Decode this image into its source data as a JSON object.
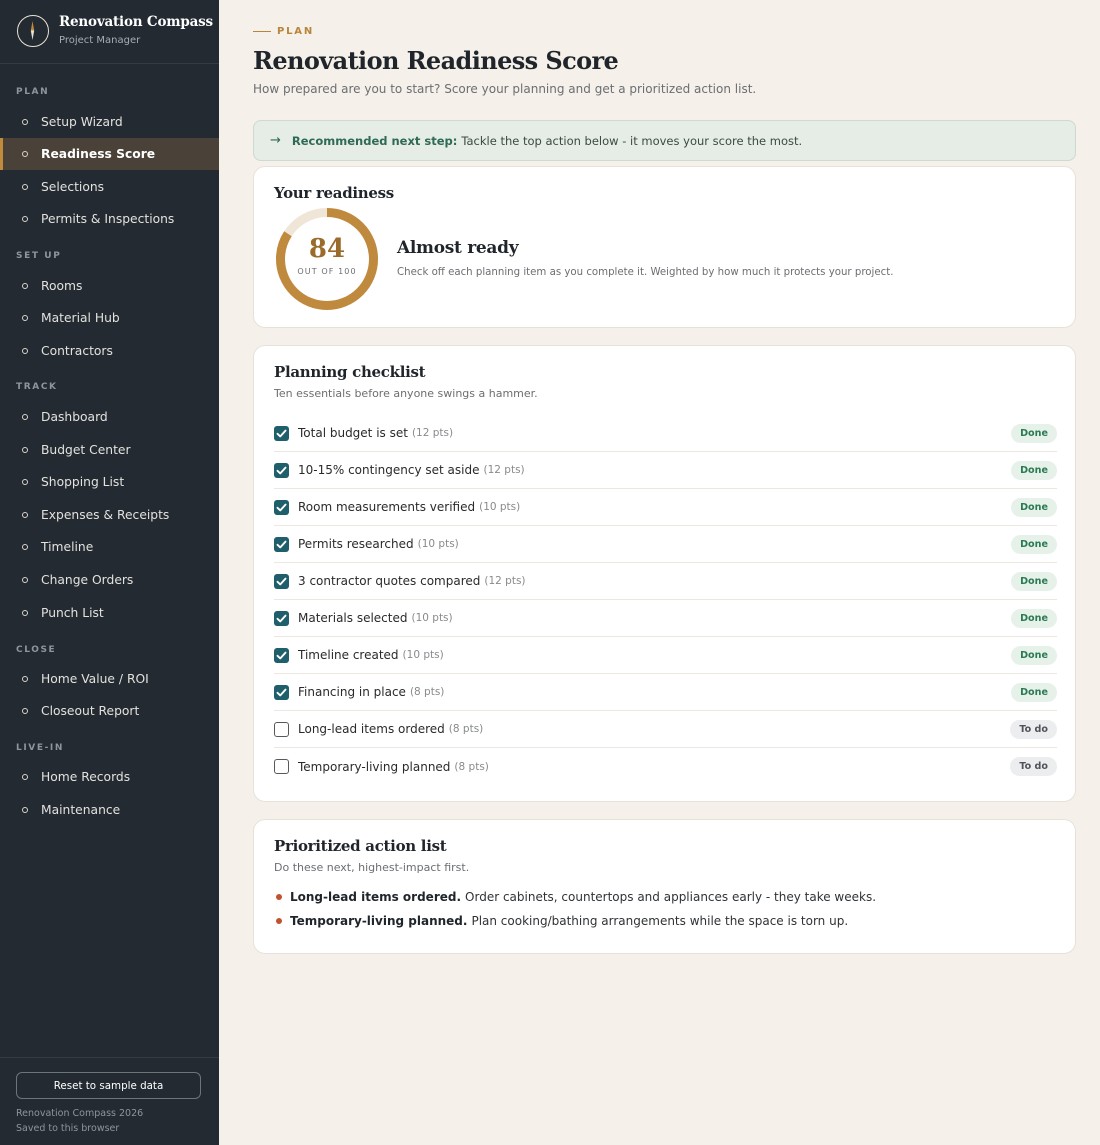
{
  "brand": {
    "title": "Renovation Compass",
    "subtitle": "Project Manager"
  },
  "sidebar": {
    "sections": [
      {
        "label": "PLAN",
        "items": [
          {
            "label": "Setup Wizard",
            "active": false
          },
          {
            "label": "Readiness Score",
            "active": true
          },
          {
            "label": "Selections",
            "active": false
          },
          {
            "label": "Permits & Inspections",
            "active": false
          }
        ]
      },
      {
        "label": "SET UP",
        "items": [
          {
            "label": "Rooms",
            "active": false
          },
          {
            "label": "Material Hub",
            "active": false
          },
          {
            "label": "Contractors",
            "active": false
          }
        ]
      },
      {
        "label": "TRACK",
        "items": [
          {
            "label": "Dashboard",
            "active": false
          },
          {
            "label": "Budget Center",
            "active": false
          },
          {
            "label": "Shopping List",
            "active": false
          },
          {
            "label": "Expenses & Receipts",
            "active": false
          },
          {
            "label": "Timeline",
            "active": false
          },
          {
            "label": "Change Orders",
            "active": false
          },
          {
            "label": "Punch List",
            "active": false
          }
        ]
      },
      {
        "label": "CLOSE",
        "items": [
          {
            "label": "Home Value / ROI",
            "active": false
          },
          {
            "label": "Closeout Report",
            "active": false
          }
        ]
      },
      {
        "label": "LIVE-IN",
        "items": [
          {
            "label": "Home Records",
            "active": false
          },
          {
            "label": "Maintenance",
            "active": false
          }
        ]
      }
    ],
    "reset_label": "Reset to sample data",
    "footer_line1": "Renovation Compass 2026",
    "footer_line2": "Saved to this browser"
  },
  "header": {
    "eyebrow": "PLAN",
    "title": "Renovation Readiness Score",
    "subtitle": "How prepared are you to start? Score your planning and get a prioritized action list."
  },
  "recommendation": {
    "icon": "arrow-right-icon",
    "label": "Recommended next step:",
    "text": "Tackle the top action below - it moves your score the most."
  },
  "readiness": {
    "title": "Your readiness",
    "score": "84",
    "score_value": 84,
    "score_max": 100,
    "score_caption": "OUT OF 100",
    "status": "Almost ready",
    "description": "Check off each planning item as you complete it. Weighted by how much it protects your project.",
    "colors": {
      "ring": "#c08a3e",
      "track": "#efe6d8"
    }
  },
  "checklist": {
    "title": "Planning checklist",
    "subtitle": "Ten essentials before anyone swings a hammer.",
    "items": [
      {
        "label": "Total budget is set",
        "pts": "(12 pts)",
        "checked": true,
        "status": "Done"
      },
      {
        "label": "10-15% contingency set aside",
        "pts": "(12 pts)",
        "checked": true,
        "status": "Done"
      },
      {
        "label": "Room measurements verified",
        "pts": "(10 pts)",
        "checked": true,
        "status": "Done"
      },
      {
        "label": "Permits researched",
        "pts": "(10 pts)",
        "checked": true,
        "status": "Done"
      },
      {
        "label": "3 contractor quotes compared",
        "pts": "(12 pts)",
        "checked": true,
        "status": "Done"
      },
      {
        "label": "Materials selected",
        "pts": "(10 pts)",
        "checked": true,
        "status": "Done"
      },
      {
        "label": "Timeline created",
        "pts": "(10 pts)",
        "checked": true,
        "status": "Done"
      },
      {
        "label": "Financing in place",
        "pts": "(8 pts)",
        "checked": true,
        "status": "Done"
      },
      {
        "label": "Long-lead items ordered",
        "pts": "(8 pts)",
        "checked": false,
        "status": "To do"
      },
      {
        "label": "Temporary-living planned",
        "pts": "(8 pts)",
        "checked": false,
        "status": "To do"
      }
    ]
  },
  "actions": {
    "title": "Prioritized action list",
    "subtitle": "Do these next, highest-impact first.",
    "items": [
      {
        "title": "Long-lead items ordered.",
        "text": "Order cabinets, countertops and appliances early - they take weeks."
      },
      {
        "title": "Temporary-living planned.",
        "text": "Plan cooking/bathing arrangements while the space is torn up."
      }
    ]
  }
}
